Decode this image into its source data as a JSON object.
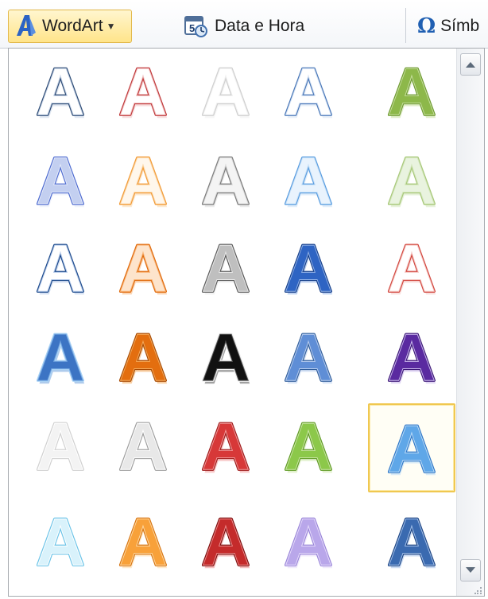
{
  "ribbon": {
    "wordart_label": "WordArt",
    "wordart_icon": "wordart-icon",
    "datetime_label": "Data e Hora",
    "datetime_icon": "calendar-clock-icon",
    "symbol_label": "Símb",
    "symbol_icon": "omega-icon"
  },
  "gallery": {
    "glyph": "A",
    "selected_index": 24,
    "scroll_up_icon": "scroll-up-arrow-icon",
    "scroll_down_icon": "scroll-down-arrow-icon",
    "items": [
      {
        "fill": "#ffffff",
        "stroke": "#2f4d77",
        "accent": "#c8d4e6"
      },
      {
        "fill": "#ffffff",
        "stroke": "#c0393b",
        "accent": "#f1c4c4"
      },
      {
        "fill": "#ffffff",
        "stroke": "#cfcfcf",
        "accent": "#f0f0f0"
      },
      {
        "fill": "#ffffff",
        "stroke": "#4a78b8",
        "accent": "#d6e2f3"
      },
      {
        "fill": "#8db84a",
        "stroke": "#6e9a32",
        "accent": "#c7df9e"
      },
      {
        "fill": "#c3cff0",
        "stroke": "#4e6bd0",
        "accent": "#e4eaf9"
      },
      {
        "fill": "#fff7ec",
        "stroke": "#f29b38",
        "accent": "#fbd7a8"
      },
      {
        "fill": "#f4f4f4",
        "stroke": "#7d7d7d",
        "accent": "#d9d9d9"
      },
      {
        "fill": "#e9f3fd",
        "stroke": "#5a9de0",
        "accent": "#c7e0f7"
      },
      {
        "fill": "#e9f3df",
        "stroke": "#a8c87a",
        "accent": "#d3e6bb"
      },
      {
        "fill": "#ffffff",
        "stroke": "#1d4a8c",
        "accent": "#b7cbea"
      },
      {
        "fill": "#fde4cc",
        "stroke": "#e06c10",
        "accent": "#f9b67a"
      },
      {
        "fill": "#bfbfbf",
        "stroke": "#5a5a5a",
        "accent": "#e8e8e8"
      },
      {
        "fill": "#2e64c3",
        "stroke": "#163f8a",
        "accent": "#8fb0e6"
      },
      {
        "fill": "#ffffff",
        "stroke": "#d2473f",
        "accent": "#f5c9c5"
      },
      {
        "fill": "#3c74c4",
        "stroke": "#a9d2f5",
        "accent": "#6fa2de"
      },
      {
        "fill": "#e36e0f",
        "stroke": "#a84c05",
        "accent": "#f4a95a"
      },
      {
        "fill": "#111111",
        "stroke": "#f0f0f0",
        "accent": "#555555"
      },
      {
        "fill": "#5f8ed6",
        "stroke": "#33609d",
        "accent": "#b8cdef"
      },
      {
        "fill": "#5a2aa0",
        "stroke": "#3d1877",
        "accent": "#c9b8ec"
      },
      {
        "fill": "#f3f3f3",
        "stroke": "#d0d0d0",
        "accent": "#ffffff"
      },
      {
        "fill": "#e8e8e8",
        "stroke": "#9e9e9e",
        "accent": "#ffffff"
      },
      {
        "fill": "#d73838",
        "stroke": "#9e1a1a",
        "accent": "#f29b9b"
      },
      {
        "fill": "#8cc84a",
        "stroke": "#5f9a24",
        "accent": "#cbe6a6"
      },
      {
        "fill": "#5fa7e8",
        "stroke": "#2f78c8",
        "accent": "#bcdcf7"
      },
      {
        "fill": "#d9f2fb",
        "stroke": "#6cc4e8",
        "accent": "#ffffff"
      },
      {
        "fill": "#f8a13a",
        "stroke": "#d77512",
        "accent": "#ffd9a3"
      },
      {
        "fill": "#c42b2b",
        "stroke": "#7d0e0e",
        "accent": "#f08d8d"
      },
      {
        "fill": "#b9a7ea",
        "stroke": "#9a86d8",
        "accent": "#e6dcfb"
      },
      {
        "fill": "#3a6ab0",
        "stroke": "#1d4584",
        "accent": "#a4c1ea"
      }
    ]
  }
}
